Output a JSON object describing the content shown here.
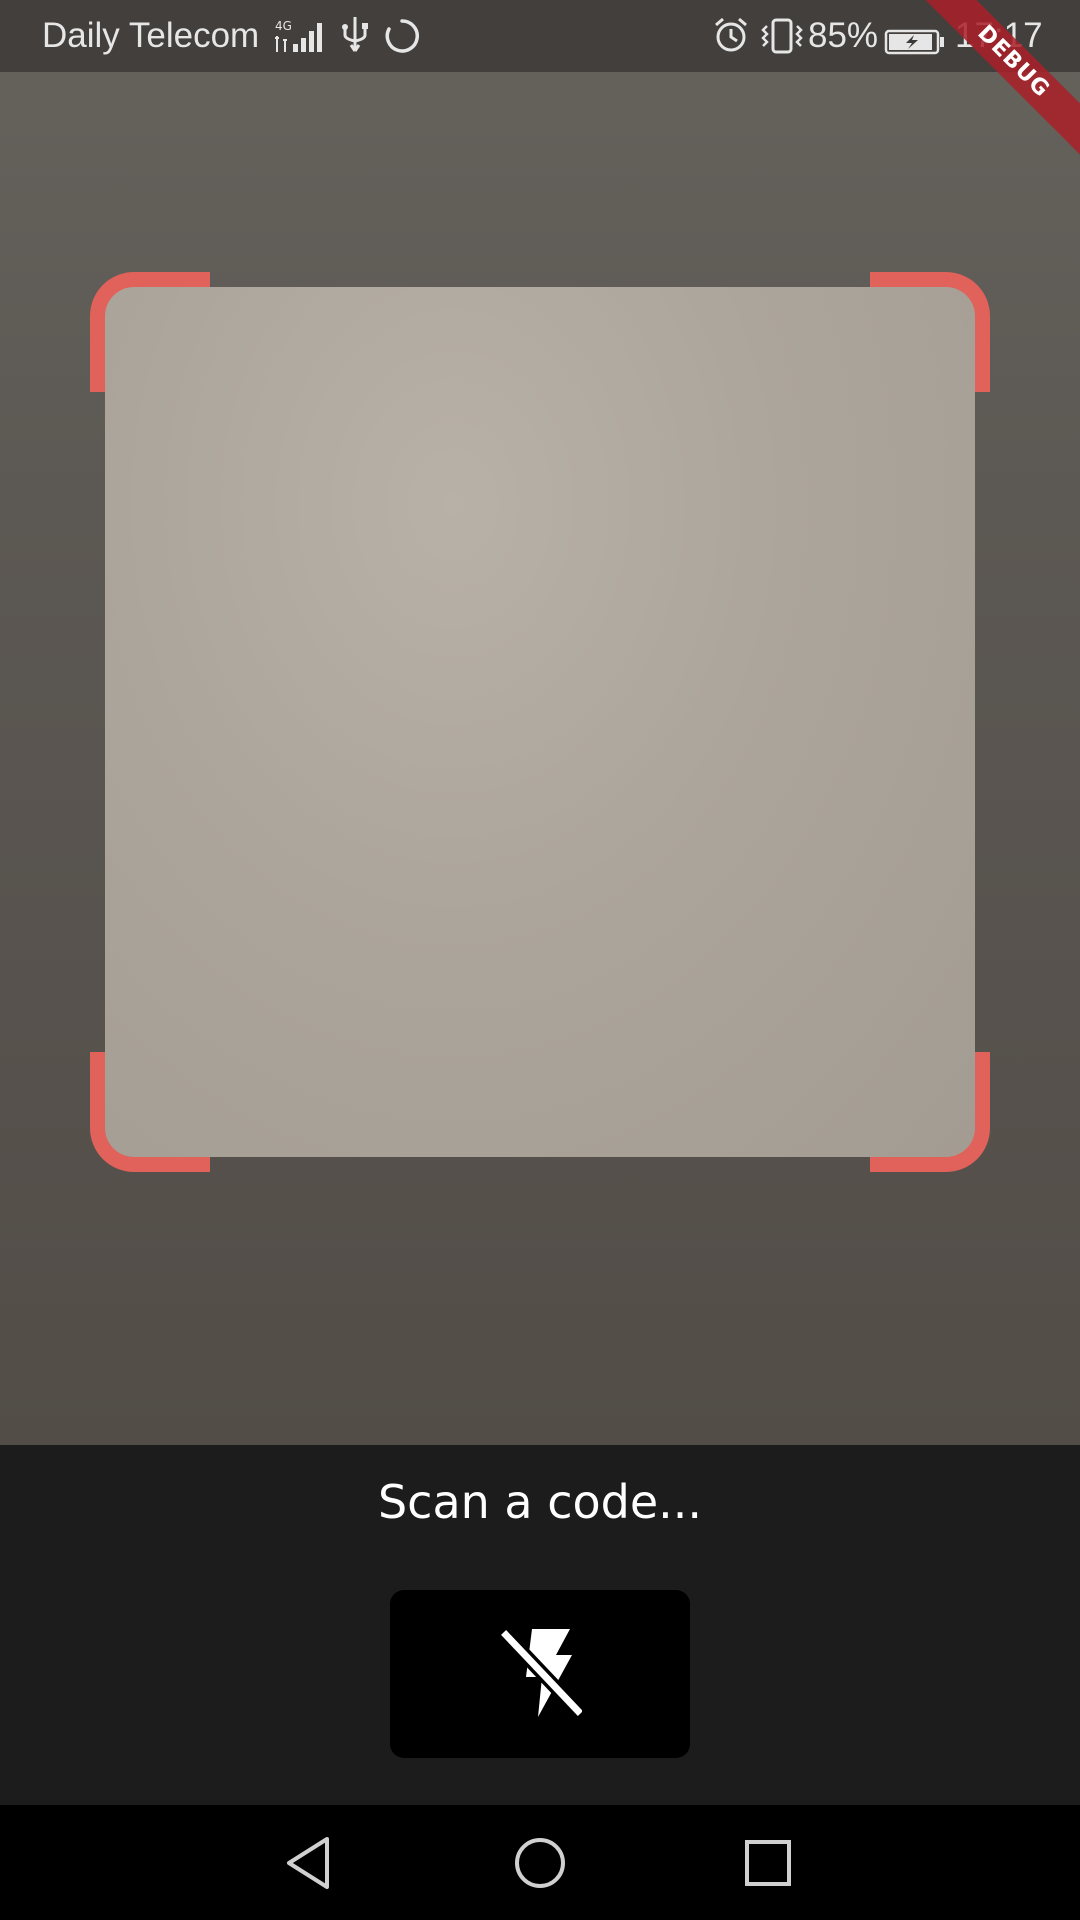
{
  "status_bar": {
    "carrier": "Daily Telecom",
    "network_type": "4G",
    "battery_percent": "85%",
    "time": "17:17",
    "icons": [
      "signal-icon",
      "usb-icon",
      "sync-icon",
      "alarm-icon",
      "vibrate-icon",
      "battery-charging-icon"
    ]
  },
  "debug_banner": "DEBUG",
  "scanner": {
    "prompt": "Scan a code...",
    "flash_icon": "flash-off-icon",
    "corner_color": "#e0625a"
  },
  "nav_bar": {
    "icons": [
      "back-icon",
      "home-icon",
      "recents-icon"
    ]
  }
}
